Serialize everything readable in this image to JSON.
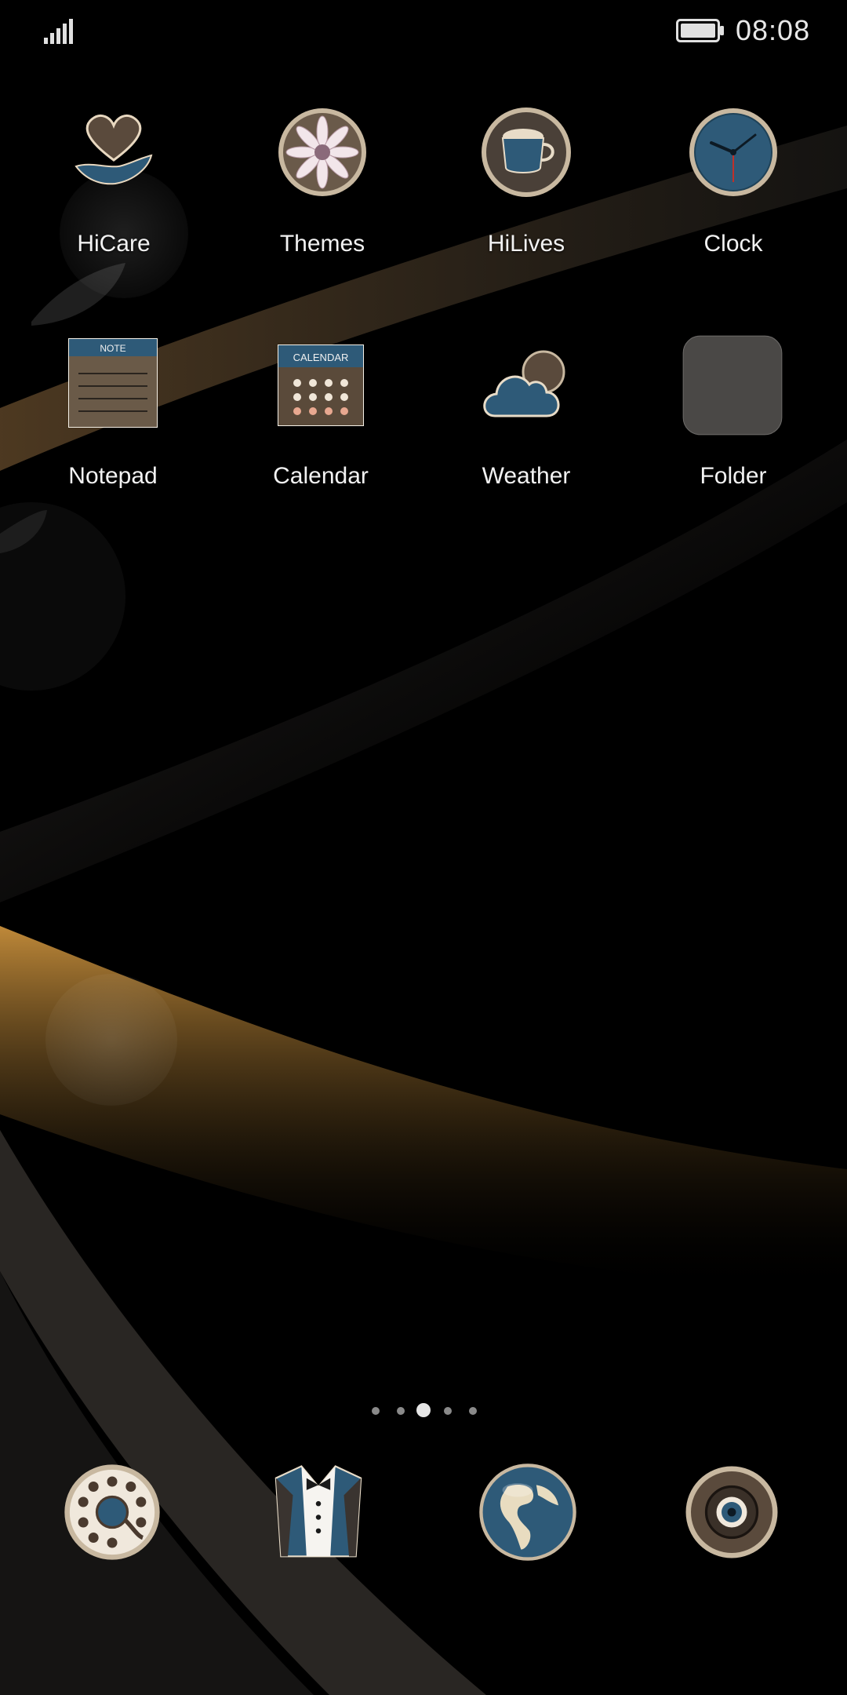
{
  "status_bar": {
    "time": "08:08",
    "signal_icon": "signal-bars-icon",
    "battery_icon": "battery-full-icon"
  },
  "apps": [
    {
      "label": "HiCare",
      "icon": "hand-heart-icon"
    },
    {
      "label": "Themes",
      "icon": "flower-icon"
    },
    {
      "label": "HiLives",
      "icon": "coffee-cup-icon"
    },
    {
      "label": "Clock",
      "icon": "clock-icon"
    },
    {
      "label": "Notepad",
      "icon": "notepad-icon",
      "icon_text": "NOTE"
    },
    {
      "label": "Calendar",
      "icon": "calendar-icon",
      "icon_text": "CALENDAR"
    },
    {
      "label": "Weather",
      "icon": "cloud-moon-icon"
    },
    {
      "label": "Folder",
      "icon": "folder-icon"
    }
  ],
  "pager": {
    "count": 5,
    "active_index": 2
  },
  "dock": [
    {
      "icon": "rotary-phone-icon"
    },
    {
      "icon": "tuxedo-icon"
    },
    {
      "icon": "globe-icon"
    },
    {
      "icon": "camera-icon"
    }
  ],
  "colors": {
    "accent_gold": "#c08a3a",
    "icon_blue": "#2e5a78",
    "icon_rim": "#c8b8a0"
  }
}
